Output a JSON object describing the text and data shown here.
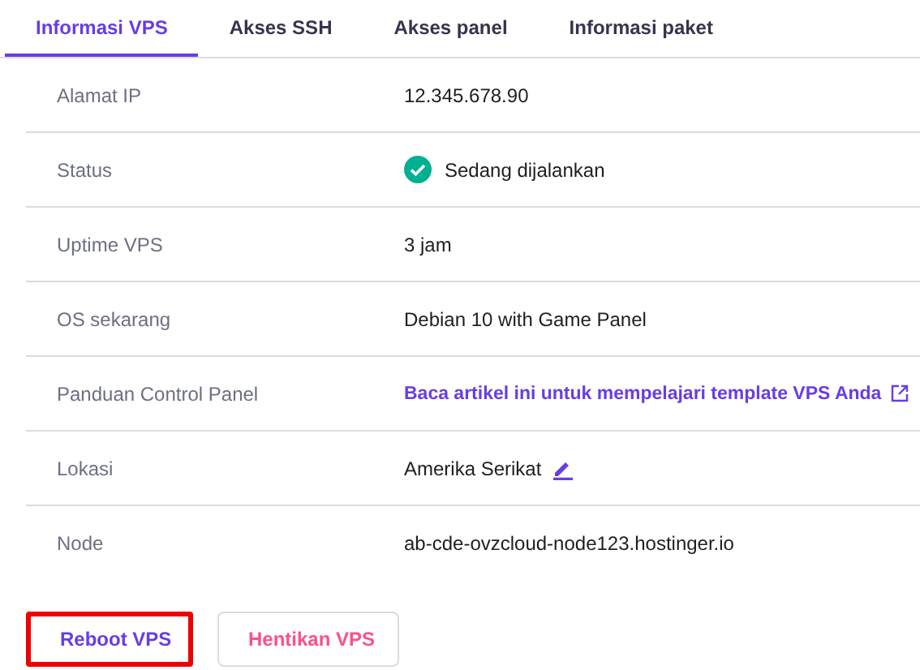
{
  "tabs": [
    {
      "label": "Informasi VPS",
      "selected": true
    },
    {
      "label": "Akses SSH",
      "selected": false
    },
    {
      "label": "Akses panel",
      "selected": false
    },
    {
      "label": "Informasi paket",
      "selected": false
    }
  ],
  "rows": [
    {
      "label": "Alamat IP",
      "kind": "text",
      "value": "12.345.678.90"
    },
    {
      "label": "Status",
      "kind": "status",
      "value": "Sedang dijalankan"
    },
    {
      "label": "Uptime VPS",
      "kind": "text",
      "value": "3 jam"
    },
    {
      "label": "OS sekarang",
      "kind": "text",
      "value": "Debian 10 with Game Panel"
    },
    {
      "label": "Panduan Control Panel",
      "kind": "link",
      "value": "Baca artikel ini untuk mempelajari template VPS Anda"
    },
    {
      "label": "Lokasi",
      "kind": "editable",
      "value": "Amerika Serikat"
    },
    {
      "label": "Node",
      "kind": "text",
      "value": "ab-cde-ovzcloud-node123.hostinger.io"
    }
  ],
  "buttons": [
    {
      "label": "Reboot VPS",
      "kind": "primary",
      "highlighted": true
    },
    {
      "label": "Hentikan VPS",
      "kind": "danger",
      "highlighted": false
    }
  ]
}
